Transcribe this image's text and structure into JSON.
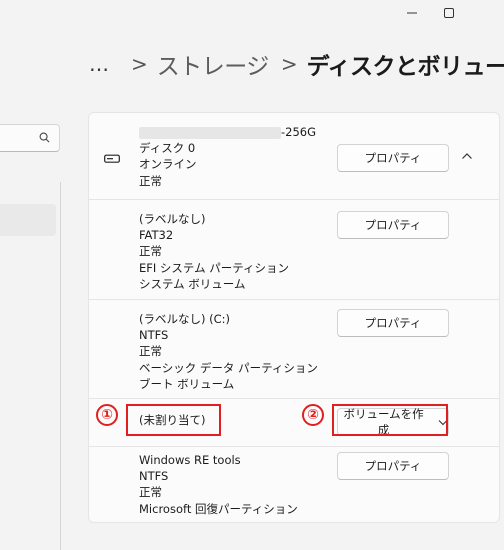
{
  "breadcrumb": {
    "more": "…",
    "separator": ">",
    "parent": "ストレージ",
    "current": "ディスクとボリューム"
  },
  "disk": {
    "name_suffix": "-256G",
    "number": "ディスク 0",
    "status": "オンライン",
    "health": "正常",
    "properties_label": "プロパティ"
  },
  "volumes": [
    {
      "lines": [
        "(ラベルなし)",
        "FAT32",
        "正常",
        "EFI システム パーティション",
        "システム ボリューム"
      ],
      "button": "プロパティ"
    },
    {
      "lines": [
        "(ラベルなし) (C:)",
        "NTFS",
        "正常",
        "ベーシック データ パーティション",
        "ブート ボリューム"
      ],
      "button": "プロパティ"
    },
    {
      "lines": [
        "(未割り当て)"
      ],
      "button": "ボリュームを作成"
    },
    {
      "lines": [
        "Windows RE tools",
        "NTFS",
        "正常",
        "Microsoft 回復パーティション"
      ],
      "button": "プロパティ"
    }
  ],
  "annotations": {
    "one": "①",
    "two": "②"
  },
  "colors": {
    "accent_red": "#e02020",
    "card_bg": "#fbfbfb",
    "page_bg": "#f3f3f3"
  },
  "icons": [
    "minimize-icon",
    "maximize-icon",
    "search-icon",
    "disk-drive-icon",
    "chevron-up-icon",
    "chevron-down-icon"
  ]
}
